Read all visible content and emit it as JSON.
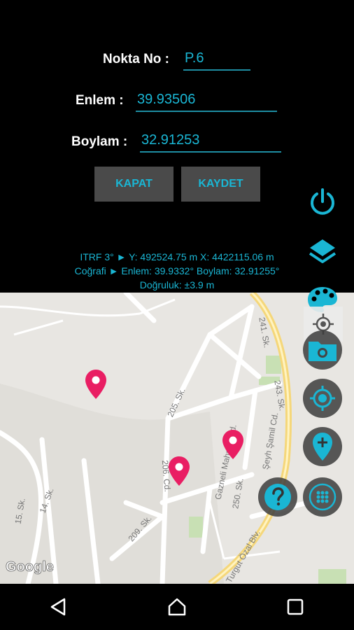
{
  "form": {
    "point_no_label": "Nokta No :",
    "point_no_value": "P.6",
    "lat_label": "Enlem :",
    "lat_value": "39.93506",
    "lon_label": "Boylam :",
    "lon_value": "32.91253"
  },
  "buttons": {
    "close_label": "KAPAT",
    "save_label": "KAYDET"
  },
  "info": {
    "itrf_line": "ITRF 3° ► Y: 492524.75 m  X: 4422115.06 m",
    "geo_line": "Coğrafi ► Enlem: 39.9332°  Boylam: 32.91255°",
    "accuracy_line": "Doğruluk: ±3.9 m"
  },
  "map": {
    "streets": [
      "241. Sk.",
      "243. Sk.",
      "205. Sk.",
      "206. Cd.",
      "Gazneli Mahmut Cd.",
      "Şeyh Şamil Cd.",
      "250. Sk.",
      "209. Sk.",
      "15. Sk.",
      "14. Sk.",
      "Turgut Özal Blv."
    ],
    "attribution": "Google",
    "marker_color": "#e91e63"
  },
  "colors": {
    "accent": "#1ab6d4",
    "button_bg": "#4a4a4a",
    "background": "#000000"
  },
  "side_icons": [
    "power-icon",
    "layers-icon",
    "palette-icon",
    "crosshair-icon",
    "camera-folder-icon",
    "my-location-icon",
    "add-marker-icon",
    "help-icon",
    "grid-menu-icon"
  ],
  "nav_icons": [
    "back-icon",
    "home-icon",
    "recents-icon"
  ]
}
